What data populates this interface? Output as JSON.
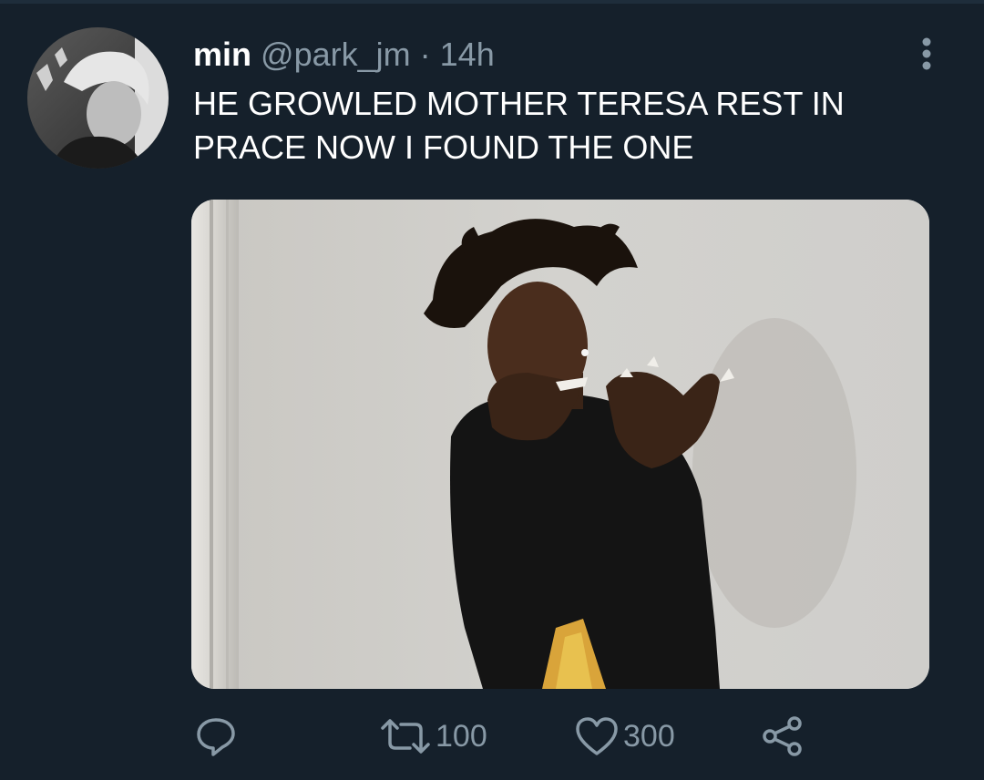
{
  "tweet": {
    "display_name": "min",
    "handle": "@park_jm",
    "separator": "·",
    "time": "14h",
    "text": "HE GROWLED MOTHER TERESA REST IN\nPRACE NOW I FOUND THE ONE",
    "avatar_icon": "user-avatar-photo",
    "media_icon": "photo-person-covering-mouth"
  },
  "actions": {
    "reply_icon": "reply-icon",
    "retweet_icon": "retweet-icon",
    "retweet_count": "100",
    "like_icon": "heart-icon",
    "like_count": "300",
    "share_icon": "share-icon"
  },
  "colors": {
    "background": "#15202b",
    "text": "#ffffff",
    "secondary": "#8899a6"
  }
}
